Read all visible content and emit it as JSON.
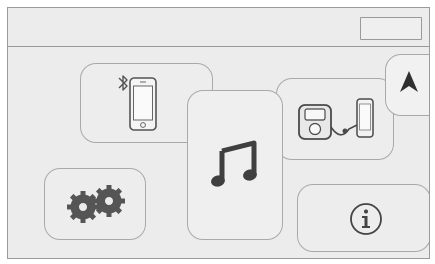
{
  "screen": {
    "topbar": {
      "status_box": ""
    },
    "tiles": [
      {
        "id": "bluetooth-phone",
        "icon": "bluetooth-phone-icon"
      },
      {
        "id": "music",
        "icon": "music-note-icon"
      },
      {
        "id": "device-connect",
        "icon": "device-connect-icon"
      },
      {
        "id": "navigation",
        "icon": "navigation-arrow-icon"
      },
      {
        "id": "settings",
        "icon": "gears-icon"
      },
      {
        "id": "info",
        "icon": "info-icon"
      }
    ]
  },
  "colors": {
    "background": "#ececec",
    "tile_border": "#a9a9a9",
    "icon": "#3f3f3f"
  }
}
